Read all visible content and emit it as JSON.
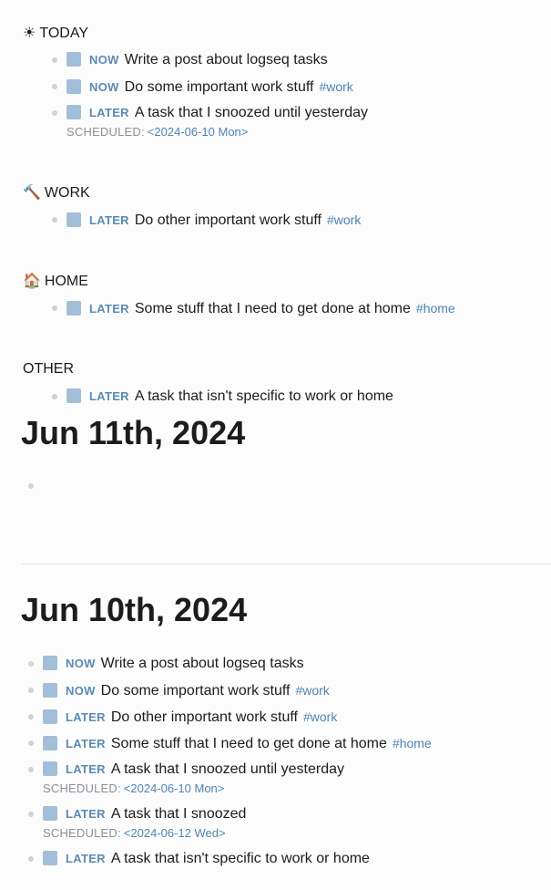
{
  "query_sections": [
    {
      "icon": "☀",
      "icon_name": "sun-icon",
      "title": "TODAY",
      "tasks": [
        {
          "marker": "NOW",
          "text": "Write a post about logseq tasks",
          "tag": ""
        },
        {
          "marker": "NOW",
          "text": "Do some important work stuff",
          "tag": "#work"
        },
        {
          "marker": "LATER",
          "text": "A task that I snoozed until yesterday",
          "tag": "",
          "scheduled_label": "SCHEDULED:",
          "scheduled_date": "<2024-06-10 Mon>"
        }
      ]
    },
    {
      "icon": "🔨",
      "icon_name": "hammer-icon",
      "title": "WORK",
      "tasks": [
        {
          "marker": "LATER",
          "text": "Do other important work stuff",
          "tag": "#work"
        }
      ]
    },
    {
      "icon": "🏠",
      "icon_name": "house-icon",
      "title": "HOME",
      "tasks": [
        {
          "marker": "LATER",
          "text": "Some stuff that I need to get done at home",
          "tag": "#home"
        }
      ]
    },
    {
      "icon": "",
      "icon_name": "",
      "title": "OTHER",
      "tasks": [
        {
          "marker": "LATER",
          "text": "A task that isn't specific to work or home",
          "tag": ""
        }
      ]
    }
  ],
  "journals": [
    {
      "title": "Jun 11th, 2024",
      "tasks": []
    },
    {
      "title": "Jun 10th, 2024",
      "tasks": [
        {
          "marker": "NOW",
          "text": "Write a post about logseq tasks",
          "tag": ""
        },
        {
          "marker": "NOW",
          "text": "Do some important work stuff",
          "tag": "#work"
        },
        {
          "marker": "LATER",
          "text": "Do other important work stuff",
          "tag": "#work"
        },
        {
          "marker": "LATER",
          "text": "Some stuff that I need to get done at home",
          "tag": "#home"
        },
        {
          "marker": "LATER",
          "text": "A task that I snoozed until yesterday",
          "tag": "",
          "scheduled_label": "SCHEDULED:",
          "scheduled_date": "<2024-06-10 Mon>"
        },
        {
          "marker": "LATER",
          "text": "A task that I snoozed",
          "tag": "",
          "scheduled_label": "SCHEDULED:",
          "scheduled_date": "<2024-06-12 Wed>"
        },
        {
          "marker": "LATER",
          "text": "A task that isn't specific to work or home",
          "tag": ""
        }
      ]
    }
  ],
  "colors": {
    "checkbox": "#a3bed8",
    "marker": "#5b8ab5",
    "tag": "#4d84b4",
    "bullet": "#cfd3d6"
  }
}
